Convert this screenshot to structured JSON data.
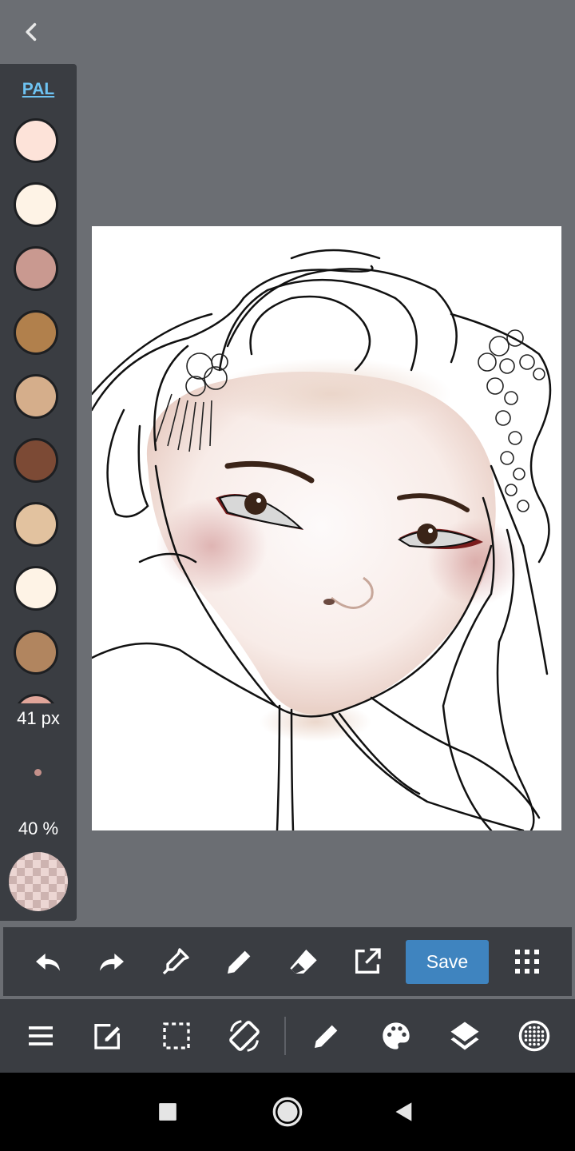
{
  "palette": {
    "label": "PAL",
    "swatches": [
      "#fde3d9",
      "#fef3e6",
      "#c99990",
      "#b1804c",
      "#d5ae8b",
      "#7c4a35",
      "#e2c29f",
      "#fef3e6",
      "#b1855f",
      "#e1a69a"
    ]
  },
  "brush": {
    "size": "41 px",
    "opacity": "40 %"
  },
  "toolbar": {
    "save_label": "Save"
  },
  "icons": {
    "back": "chevron-left-icon",
    "top": [
      "undo-icon",
      "redo-icon",
      "eyedropper-icon",
      "pencil-icon",
      "eraser-icon",
      "open-external-icon",
      "grid-icon"
    ],
    "bottom": [
      "menu-icon",
      "edit-icon",
      "selection-icon",
      "rotate-screen-icon",
      "pen-icon",
      "palette-icon",
      "layers-icon",
      "dotted-circle-icon"
    ]
  },
  "colors": {
    "accent": "#3f84bf",
    "panel": "#3a3d42",
    "background": "#6b6e73"
  }
}
